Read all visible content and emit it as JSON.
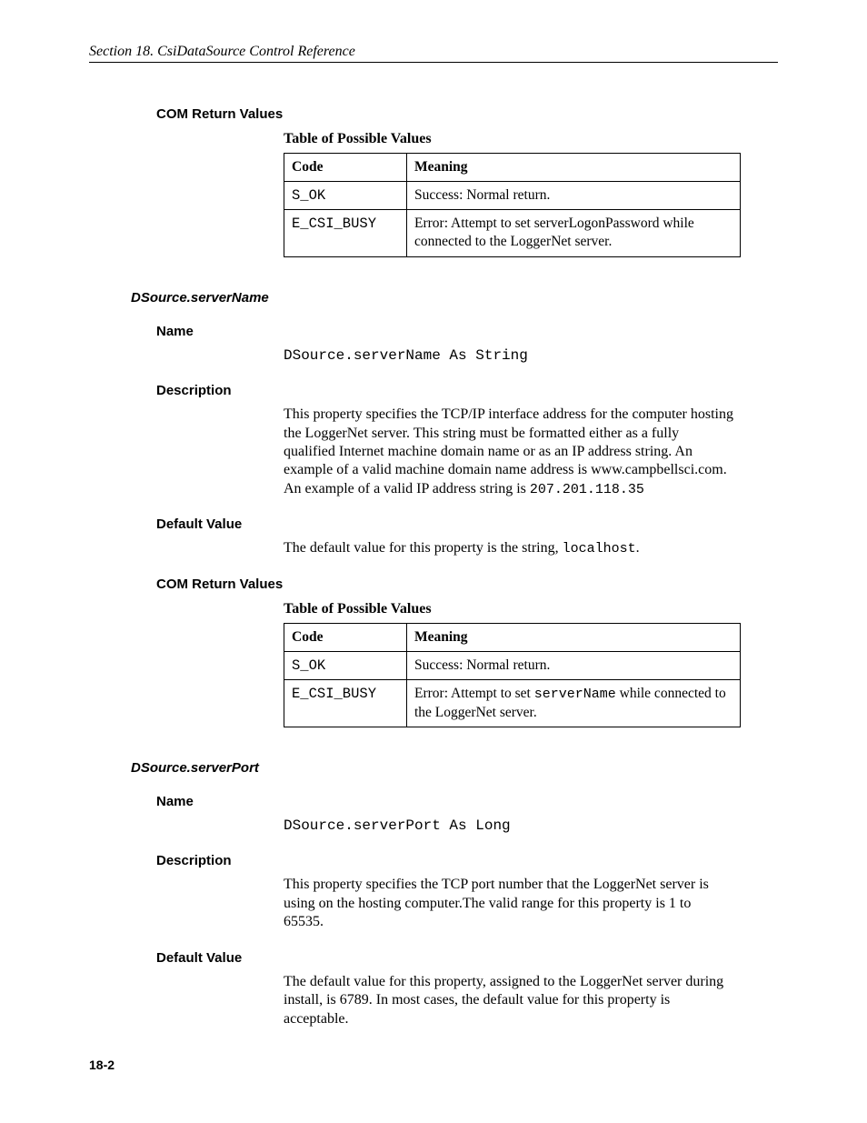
{
  "header": "Section 18.  CsiDataSource Control Reference",
  "page_number": "18-2",
  "section1": {
    "com_heading": "COM Return Values",
    "table_title": "Table of Possible Values",
    "th_code": "Code",
    "th_meaning": "Meaning",
    "r1_code": "S_OK",
    "r1_meaning": "Success: Normal return.",
    "r2_code": "E_CSI_BUSY",
    "r2_meaning": "Error: Attempt to set serverLogonPassword while connected to the LoggerNet server."
  },
  "serverName": {
    "title": "DSource.serverName",
    "h_name": "Name",
    "sig": "DSource.serverName As String",
    "h_desc": "Description",
    "desc": "This property specifies the TCP/IP interface address for the computer hosting the LoggerNet server.  This string must be formatted either as a fully qualified Internet machine domain name or as an IP address string.  An example of a valid machine domain name address is www.campbellsci.com. An example of a valid IP address string is ",
    "desc_code_tail": "207.201.118.35",
    "h_default": "Default Value",
    "default_pre": "The default value for this property is the string, ",
    "default_code": "localhost",
    "default_post": ".",
    "com_heading": "COM Return Values",
    "table_title": "Table of Possible Values",
    "th_code": "Code",
    "th_meaning": "Meaning",
    "r1_code": "S_OK",
    "r1_meaning": "Success: Normal return.",
    "r2_code": "E_CSI_BUSY",
    "r2_meaning_pre": "Error: Attempt to set ",
    "r2_meaning_code": "serverName",
    "r2_meaning_post": " while connected to the LoggerNet server."
  },
  "serverPort": {
    "title": "DSource.serverPort",
    "h_name": "Name",
    "sig": "DSource.serverPort As Long",
    "h_desc": "Description",
    "desc": "This property specifies the TCP port number that the LoggerNet server is using on the hosting computer.The valid range for this property is 1 to 65535.",
    "h_default": "Default Value",
    "default": "The default value for this property, assigned to the LoggerNet server during install, is 6789.  In most cases, the default value for this property is acceptable."
  }
}
